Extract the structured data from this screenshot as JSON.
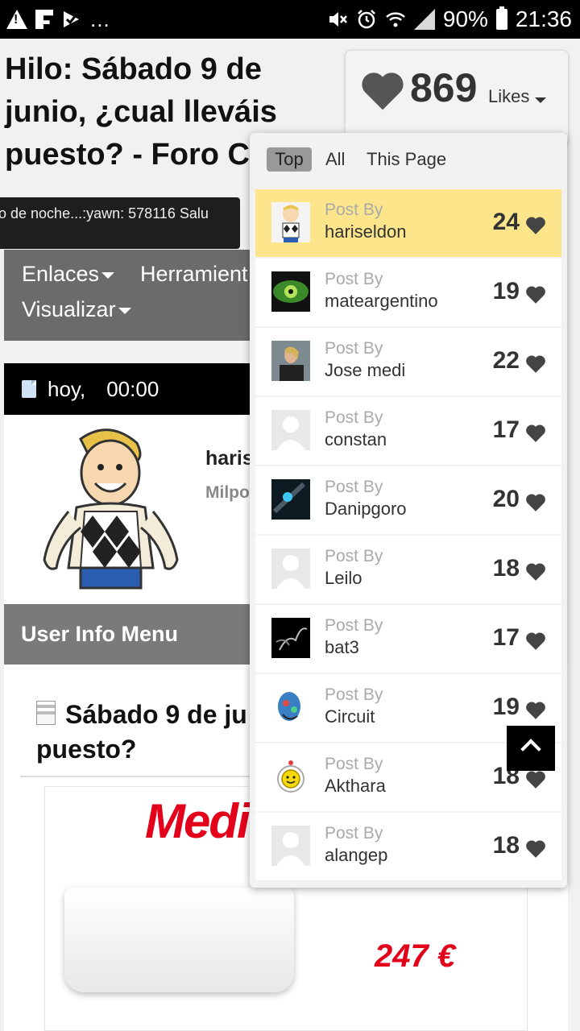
{
  "status_bar": {
    "left_dots": "...",
    "battery": "90%",
    "time": "21:36"
  },
  "page": {
    "title": "Hilo: Sábado 9 de junio, ¿cual lleváis puesto? - Foro C",
    "tooltip": "o de noche...:yawn: 578116 Salu",
    "nav": {
      "links": "Enlaces",
      "tools": "Herramient",
      "view": "Visualizar"
    },
    "date": "hoy,",
    "time": "00:00",
    "username": "haris",
    "user_rank": "Milpo",
    "user_info_menu": "User Info Menu",
    "post_title": "Sábado 9 de ju puesto?",
    "ad": {
      "logo": "Medi",
      "price": "247 €"
    }
  },
  "likes": {
    "count": "869",
    "label": "Likes",
    "tabs": [
      "Top",
      "All",
      "This Page"
    ],
    "entries": [
      {
        "label": "Post By",
        "name": "hariseldon",
        "count": "24",
        "highlight": true
      },
      {
        "label": "Post By",
        "name": "mateargentino",
        "count": "19"
      },
      {
        "label": "Post By",
        "name": "Jose medi",
        "count": "22"
      },
      {
        "label": "Post By",
        "name": "constan",
        "count": "17"
      },
      {
        "label": "Post By",
        "name": "Danipgoro",
        "count": "20"
      },
      {
        "label": "Post By",
        "name": "Leilo",
        "count": "18"
      },
      {
        "label": "Post By",
        "name": "bat3",
        "count": "17"
      },
      {
        "label": "Post By",
        "name": "Circuit",
        "count": "19"
      },
      {
        "label": "Post By",
        "name": "Akthara",
        "count": "18"
      },
      {
        "label": "Post By",
        "name": "alangep",
        "count": "18"
      }
    ]
  },
  "colors": {
    "highlight_row": "#fce58a",
    "ad_red": "#e3001b",
    "nav_gray": "#6b6b6b"
  }
}
